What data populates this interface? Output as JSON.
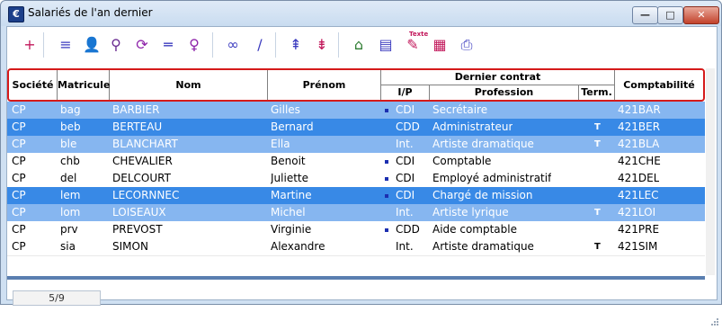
{
  "window": {
    "title": "Salariés de l'an dernier",
    "app_icon_glyph": "€",
    "minimize_glyph": "—",
    "maximize_glyph": "□",
    "close_glyph": "✕"
  },
  "toolbar": {
    "icons": [
      {
        "name": "add-icon",
        "glyph": "+",
        "color": "#c2185b"
      },
      {
        "name": "list-star-icon",
        "glyph": "≡",
        "color": "#3b3bbf"
      },
      {
        "name": "user-add-icon",
        "glyph": "👤",
        "color": "#c2185b"
      },
      {
        "name": "user-edit-icon",
        "glyph": "⚲",
        "color": "#6a2c91"
      },
      {
        "name": "refresh-icon",
        "glyph": "⟳",
        "color": "#8e24aa"
      },
      {
        "name": "equals-icon",
        "glyph": "═",
        "color": "#3b3bbf"
      },
      {
        "name": "search-icon",
        "glyph": "♀",
        "color": "#8e24aa"
      },
      {
        "name": "glasses-icon",
        "glyph": "∞",
        "color": "#3b3bbf"
      },
      {
        "name": "pen-icon",
        "glyph": "/",
        "color": "#3b3bbf"
      },
      {
        "name": "sort-up-icon",
        "glyph": "⇞",
        "color": "#3b3bbf"
      },
      {
        "name": "sort-down-icon",
        "glyph": "⇟",
        "color": "#c2185b"
      },
      {
        "name": "home-add-icon",
        "glyph": "⌂",
        "color": "#2e7d32"
      },
      {
        "name": "document-add-icon",
        "glyph": "▤",
        "color": "#3b3bbf"
      },
      {
        "name": "text-edit-icon",
        "glyph": "✎",
        "color": "#c2185b"
      },
      {
        "name": "chart-icon",
        "glyph": "▦",
        "color": "#c2185b"
      },
      {
        "name": "print-icon",
        "glyph": "⎙",
        "color": "#3b3bbf"
      }
    ],
    "text_icon_label": "Texte"
  },
  "grid": {
    "headers": {
      "societe": "Société",
      "matricule": "Matricule",
      "nom": "Nom",
      "prenom": "Prénom",
      "dernier_contrat": "Dernier contrat",
      "ip": "I/P",
      "profession": "Profession",
      "term": "Term.",
      "comptabilite": "Comptabilité"
    },
    "rows": [
      {
        "style": "sel-light",
        "societe": "CP",
        "matricule": "bag",
        "nom": "BARBIER",
        "prenom": "Gilles",
        "bullet": true,
        "ip": "CDI",
        "profession": "Secrétaire",
        "term": "",
        "compta": "421BAR"
      },
      {
        "style": "sel-dark",
        "societe": "CP",
        "matricule": "beb",
        "nom": "BERTEAU",
        "prenom": "Bernard",
        "bullet": false,
        "ip": "CDD",
        "profession": "Administrateur",
        "term": "T",
        "compta": "421BER"
      },
      {
        "style": "sel-light",
        "societe": "CP",
        "matricule": "ble",
        "nom": "BLANCHART",
        "prenom": "Ella",
        "bullet": false,
        "ip": "Int.",
        "profession": "Artiste dramatique",
        "term": "T",
        "compta": "421BLA"
      },
      {
        "style": "plain",
        "societe": "CP",
        "matricule": "chb",
        "nom": "CHEVALIER",
        "prenom": "Benoit",
        "bullet": true,
        "ip": "CDI",
        "profession": "Comptable",
        "term": "",
        "compta": "421CHE"
      },
      {
        "style": "plain",
        "societe": "CP",
        "matricule": "del",
        "nom": "DELCOURT",
        "prenom": "Juliette",
        "bullet": true,
        "ip": "CDI",
        "profession": "Employé administratif",
        "term": "",
        "compta": "421DEL"
      },
      {
        "style": "sel-dark",
        "societe": "CP",
        "matricule": "lem",
        "nom": "LECORNNEC",
        "prenom": "Martine",
        "bullet": true,
        "ip": "CDI",
        "profession": "Chargé de mission",
        "term": "",
        "compta": "421LEC"
      },
      {
        "style": "sel-light",
        "societe": "CP",
        "matricule": "lom",
        "nom": "LOISEAUX",
        "prenom": "Michel",
        "bullet": false,
        "ip": "Int.",
        "profession": "Artiste lyrique",
        "term": "T",
        "compta": "421LOI"
      },
      {
        "style": "plain",
        "societe": "CP",
        "matricule": "prv",
        "nom": "PREVOST",
        "prenom": "Virginie",
        "bullet": true,
        "ip": "CDD",
        "profession": "Aide comptable",
        "term": "",
        "compta": "421PRE"
      },
      {
        "style": "plain",
        "societe": "CP",
        "matricule": "sia",
        "nom": "SIMON",
        "prenom": "Alexandre",
        "bullet": false,
        "ip": "Int.",
        "profession": "Artiste dramatique",
        "term": "T",
        "compta": "421SIM"
      }
    ]
  },
  "status": {
    "record_position": "5/9"
  },
  "colors": {
    "selection_light": "#86b6f0",
    "selection_dark": "#3889e6",
    "header_outline": "#d51a1a"
  }
}
